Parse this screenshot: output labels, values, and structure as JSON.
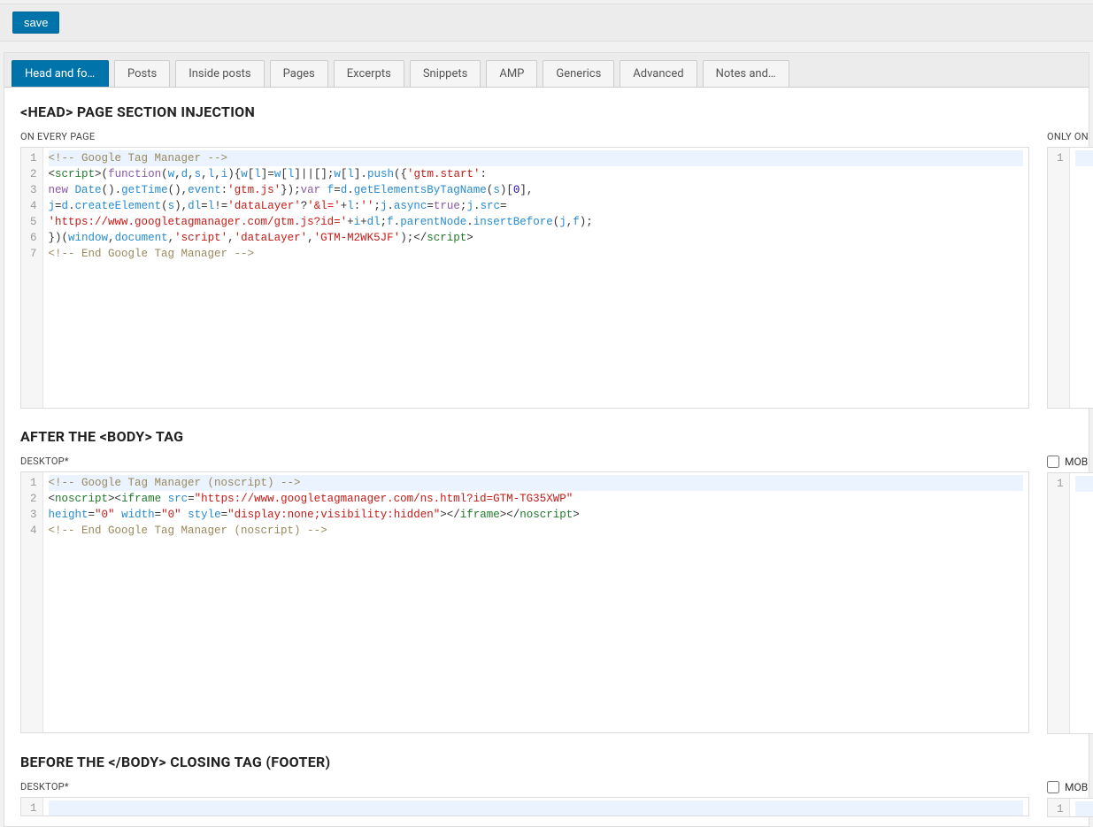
{
  "toolbar": {
    "save_label": "save"
  },
  "tabs": [
    {
      "label": "Head and footer",
      "active": true
    },
    {
      "label": "Posts"
    },
    {
      "label": "Inside posts"
    },
    {
      "label": "Pages"
    },
    {
      "label": "Excerpts"
    },
    {
      "label": "Snippets"
    },
    {
      "label": "AMP"
    },
    {
      "label": "Generics"
    },
    {
      "label": "Advanced"
    },
    {
      "label": "Notes and…"
    }
  ],
  "sections": {
    "head": {
      "title": "<HEAD> PAGE SECTION INJECTION",
      "left_label": "ON EVERY PAGE",
      "right_label": "ONLY ON",
      "left_code_lines": [
        [
          {
            "t": "comment",
            "v": "<!-- Google Tag Manager -->"
          }
        ],
        [
          {
            "t": "op",
            "v": "<"
          },
          {
            "t": "tag",
            "v": "script"
          },
          {
            "t": "op",
            "v": ">("
          },
          {
            "t": "kw",
            "v": "function"
          },
          {
            "t": "op",
            "v": "("
          },
          {
            "t": "var",
            "v": "w"
          },
          {
            "t": "op",
            "v": ","
          },
          {
            "t": "var",
            "v": "d"
          },
          {
            "t": "op",
            "v": ","
          },
          {
            "t": "var",
            "v": "s"
          },
          {
            "t": "op",
            "v": ","
          },
          {
            "t": "var",
            "v": "l"
          },
          {
            "t": "op",
            "v": ","
          },
          {
            "t": "var",
            "v": "i"
          },
          {
            "t": "op",
            "v": "){"
          },
          {
            "t": "var",
            "v": "w"
          },
          {
            "t": "op",
            "v": "["
          },
          {
            "t": "var",
            "v": "l"
          },
          {
            "t": "op",
            "v": "]="
          },
          {
            "t": "var",
            "v": "w"
          },
          {
            "t": "op",
            "v": "["
          },
          {
            "t": "var",
            "v": "l"
          },
          {
            "t": "op",
            "v": "]||[];"
          },
          {
            "t": "var",
            "v": "w"
          },
          {
            "t": "op",
            "v": "["
          },
          {
            "t": "var",
            "v": "l"
          },
          {
            "t": "op",
            "v": "]."
          },
          {
            "t": "fn",
            "v": "push"
          },
          {
            "t": "op",
            "v": "({"
          },
          {
            "t": "str",
            "v": "'gtm.start'"
          },
          {
            "t": "op",
            "v": ":"
          }
        ],
        [
          {
            "t": "kw",
            "v": "new"
          },
          {
            "t": "op",
            "v": " "
          },
          {
            "t": "fn",
            "v": "Date"
          },
          {
            "t": "op",
            "v": "()."
          },
          {
            "t": "fn",
            "v": "getTime"
          },
          {
            "t": "op",
            "v": "(),"
          },
          {
            "t": "var",
            "v": "event"
          },
          {
            "t": "op",
            "v": ":"
          },
          {
            "t": "str",
            "v": "'gtm.js'"
          },
          {
            "t": "op",
            "v": "});"
          },
          {
            "t": "kw",
            "v": "var"
          },
          {
            "t": "op",
            "v": " "
          },
          {
            "t": "var",
            "v": "f"
          },
          {
            "t": "op",
            "v": "="
          },
          {
            "t": "var",
            "v": "d"
          },
          {
            "t": "op",
            "v": "."
          },
          {
            "t": "fn",
            "v": "getElementsByTagName"
          },
          {
            "t": "op",
            "v": "("
          },
          {
            "t": "var",
            "v": "s"
          },
          {
            "t": "op",
            "v": ")["
          },
          {
            "t": "num",
            "v": "0"
          },
          {
            "t": "op",
            "v": "],"
          }
        ],
        [
          {
            "t": "var",
            "v": "j"
          },
          {
            "t": "op",
            "v": "="
          },
          {
            "t": "var",
            "v": "d"
          },
          {
            "t": "op",
            "v": "."
          },
          {
            "t": "fn",
            "v": "createElement"
          },
          {
            "t": "op",
            "v": "("
          },
          {
            "t": "var",
            "v": "s"
          },
          {
            "t": "op",
            "v": "),"
          },
          {
            "t": "var",
            "v": "dl"
          },
          {
            "t": "op",
            "v": "="
          },
          {
            "t": "var",
            "v": "l"
          },
          {
            "t": "op",
            "v": "!="
          },
          {
            "t": "str",
            "v": "'dataLayer'"
          },
          {
            "t": "op",
            "v": "?"
          },
          {
            "t": "str",
            "v": "'&l='"
          },
          {
            "t": "op",
            "v": "+"
          },
          {
            "t": "var",
            "v": "l"
          },
          {
            "t": "op",
            "v": ":"
          },
          {
            "t": "str",
            "v": "''"
          },
          {
            "t": "op",
            "v": ";"
          },
          {
            "t": "var",
            "v": "j"
          },
          {
            "t": "op",
            "v": "."
          },
          {
            "t": "var",
            "v": "async"
          },
          {
            "t": "op",
            "v": "="
          },
          {
            "t": "bool",
            "v": "true"
          },
          {
            "t": "op",
            "v": ";"
          },
          {
            "t": "var",
            "v": "j"
          },
          {
            "t": "op",
            "v": "."
          },
          {
            "t": "var",
            "v": "src"
          },
          {
            "t": "op",
            "v": "="
          }
        ],
        [
          {
            "t": "str",
            "v": "'https://www.googletagmanager.com/gtm.js?id='"
          },
          {
            "t": "op",
            "v": "+"
          },
          {
            "t": "var",
            "v": "i"
          },
          {
            "t": "op",
            "v": "+"
          },
          {
            "t": "var",
            "v": "dl"
          },
          {
            "t": "op",
            "v": ";"
          },
          {
            "t": "var",
            "v": "f"
          },
          {
            "t": "op",
            "v": "."
          },
          {
            "t": "var",
            "v": "parentNode"
          },
          {
            "t": "op",
            "v": "."
          },
          {
            "t": "fn",
            "v": "insertBefore"
          },
          {
            "t": "op",
            "v": "("
          },
          {
            "t": "var",
            "v": "j"
          },
          {
            "t": "op",
            "v": ","
          },
          {
            "t": "var",
            "v": "f"
          },
          {
            "t": "op",
            "v": ");"
          }
        ],
        [
          {
            "t": "op",
            "v": "})("
          },
          {
            "t": "var",
            "v": "window"
          },
          {
            "t": "op",
            "v": ","
          },
          {
            "t": "var",
            "v": "document"
          },
          {
            "t": "op",
            "v": ","
          },
          {
            "t": "str",
            "v": "'script'"
          },
          {
            "t": "op",
            "v": ","
          },
          {
            "t": "str",
            "v": "'dataLayer'"
          },
          {
            "t": "op",
            "v": ","
          },
          {
            "t": "str",
            "v": "'GTM-M2WK5JF'"
          },
          {
            "t": "op",
            "v": ");</"
          },
          {
            "t": "tag",
            "v": "script"
          },
          {
            "t": "op",
            "v": ">"
          }
        ],
        [
          {
            "t": "comment",
            "v": "<!-- End Google Tag Manager -->"
          }
        ]
      ],
      "right_code_lines": [
        []
      ]
    },
    "after_body": {
      "title": "AFTER THE <BODY> TAG",
      "left_label": "DESKTOP*",
      "right_label": "MOB",
      "left_code_lines": [
        [
          {
            "t": "comment",
            "v": "<!-- Google Tag Manager (noscript) -->"
          }
        ],
        [
          {
            "t": "op",
            "v": "<"
          },
          {
            "t": "tag",
            "v": "noscript"
          },
          {
            "t": "op",
            "v": "><"
          },
          {
            "t": "tag",
            "v": "iframe"
          },
          {
            "t": "op",
            "v": " "
          },
          {
            "t": "attr",
            "v": "src"
          },
          {
            "t": "op",
            "v": "="
          },
          {
            "t": "str",
            "v": "\"https://www.googletagmanager.com/ns.html?id=GTM-TG35XWP\""
          }
        ],
        [
          {
            "t": "attr",
            "v": "height"
          },
          {
            "t": "op",
            "v": "="
          },
          {
            "t": "str",
            "v": "\"0\""
          },
          {
            "t": "op",
            "v": " "
          },
          {
            "t": "attr",
            "v": "width"
          },
          {
            "t": "op",
            "v": "="
          },
          {
            "t": "str",
            "v": "\"0\""
          },
          {
            "t": "op",
            "v": " "
          },
          {
            "t": "attr",
            "v": "style"
          },
          {
            "t": "op",
            "v": "="
          },
          {
            "t": "str",
            "v": "\"display:none;visibility:hidden\""
          },
          {
            "t": "op",
            "v": "></"
          },
          {
            "t": "tag",
            "v": "iframe"
          },
          {
            "t": "op",
            "v": "></"
          },
          {
            "t": "tag",
            "v": "noscript"
          },
          {
            "t": "op",
            "v": ">"
          }
        ],
        [
          {
            "t": "comment",
            "v": "<!-- End Google Tag Manager (noscript) -->"
          }
        ]
      ],
      "right_code_lines": [
        []
      ]
    },
    "footer": {
      "title": "BEFORE THE </BODY> CLOSING TAG (FOOTER)",
      "left_label": "DESKTOP*",
      "right_label": "MOB",
      "left_code_lines": [
        []
      ],
      "right_code_lines": [
        []
      ]
    }
  }
}
